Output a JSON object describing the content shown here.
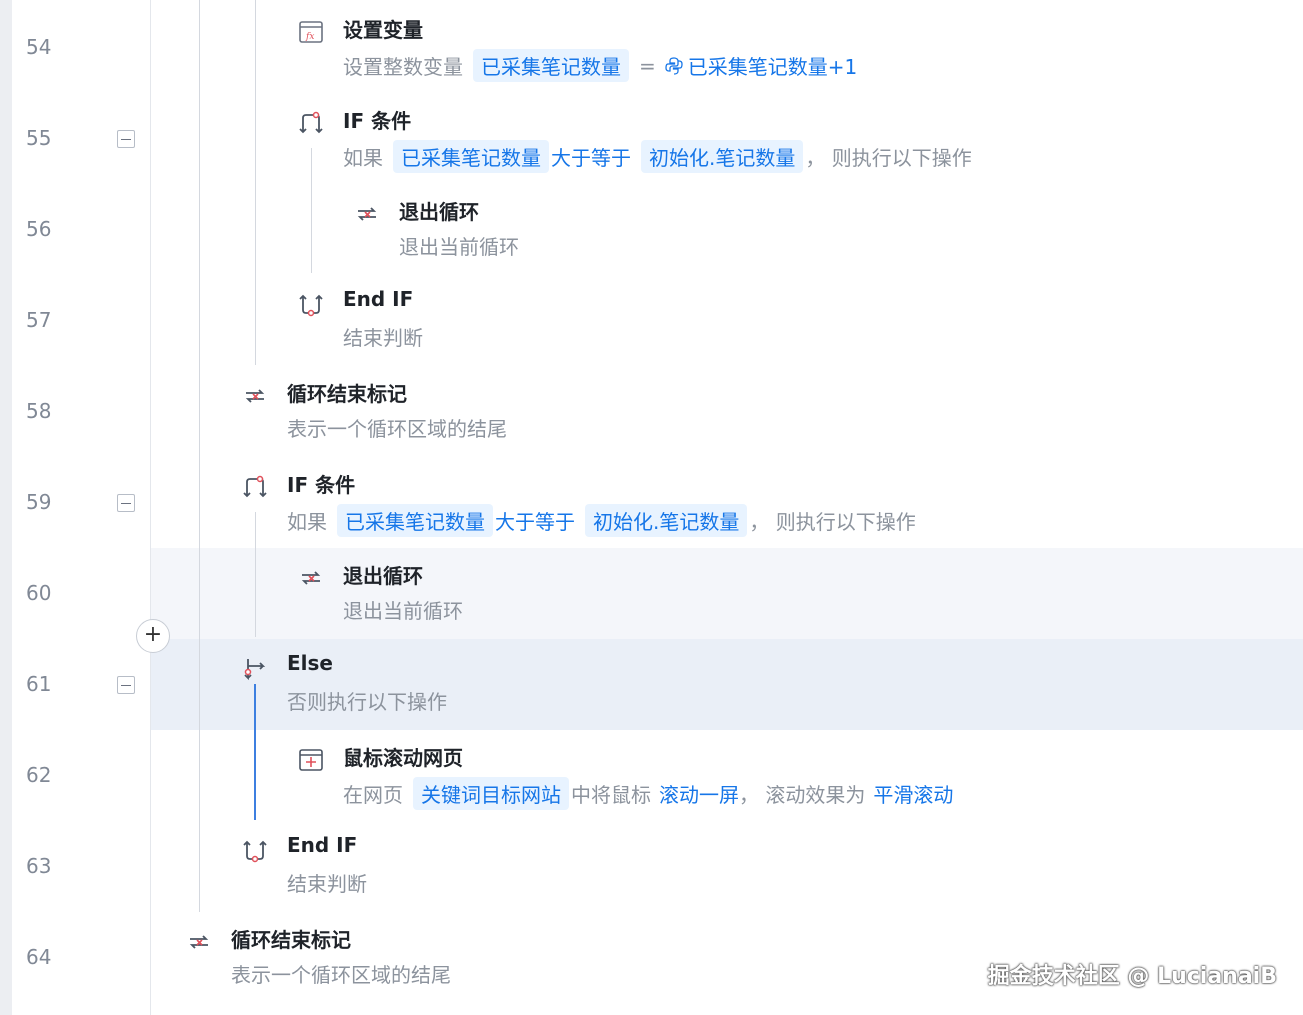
{
  "line_numbers": [
    "54",
    "55",
    "56",
    "57",
    "58",
    "59",
    "60",
    "61",
    "62",
    "63",
    "64"
  ],
  "add_button_label": "+",
  "steps": {
    "s54": {
      "title": "设置变量",
      "desc_prefix": "设置整数变量",
      "var_chip": "已采集笔记数量",
      "equals": "=",
      "expr": "已采集笔记数量+1"
    },
    "s55": {
      "title": "IF 条件",
      "if_prefix": "如果",
      "lhs_chip": "已采集笔记数量",
      "operator": "大于等于",
      "rhs_chip": "初始化.笔记数量",
      "suffix": "，  则执行以下操作"
    },
    "s56": {
      "title": "退出循环",
      "desc": "退出当前循环"
    },
    "s57": {
      "title": "End IF",
      "desc": "结束判断"
    },
    "s58": {
      "title": "循环结束标记",
      "desc": "表示一个循环区域的结尾"
    },
    "s59": {
      "title": "IF 条件",
      "if_prefix": "如果",
      "lhs_chip": "已采集笔记数量",
      "operator": "大于等于",
      "rhs_chip": "初始化.笔记数量",
      "suffix": "，  则执行以下操作"
    },
    "s60": {
      "title": "退出循环",
      "desc": "退出当前循环"
    },
    "s61": {
      "title": "Else",
      "desc": "否则执行以下操作"
    },
    "s62": {
      "title": "鼠标滚动网页",
      "prefix": "在网页",
      "page_chip": "关键词目标网站",
      "middle": "中将鼠标",
      "scroll_amount": "滚动一屏",
      "middle2": "，  滚动效果为",
      "scroll_effect": "平滑滚动"
    },
    "s63": {
      "title": "End IF",
      "desc": "结束判断"
    },
    "s64": {
      "title": "循环结束标记",
      "desc": "表示一个循环区域的结尾"
    }
  },
  "watermark": "掘金技术社区 @ LucianaiB",
  "icons": {
    "set_var": "fx-icon",
    "if": "if-branch-icon",
    "exit_loop": "exit-loop-icon",
    "end_if": "end-if-icon",
    "loop_end": "loop-end-icon",
    "else": "else-branch-icon",
    "scroll": "browser-scroll-icon"
  },
  "colors": {
    "accent": "#1676e8",
    "chip_bg": "#e8f3ff",
    "icon_red": "#e0505a",
    "selected_row": "#eaeff7"
  }
}
